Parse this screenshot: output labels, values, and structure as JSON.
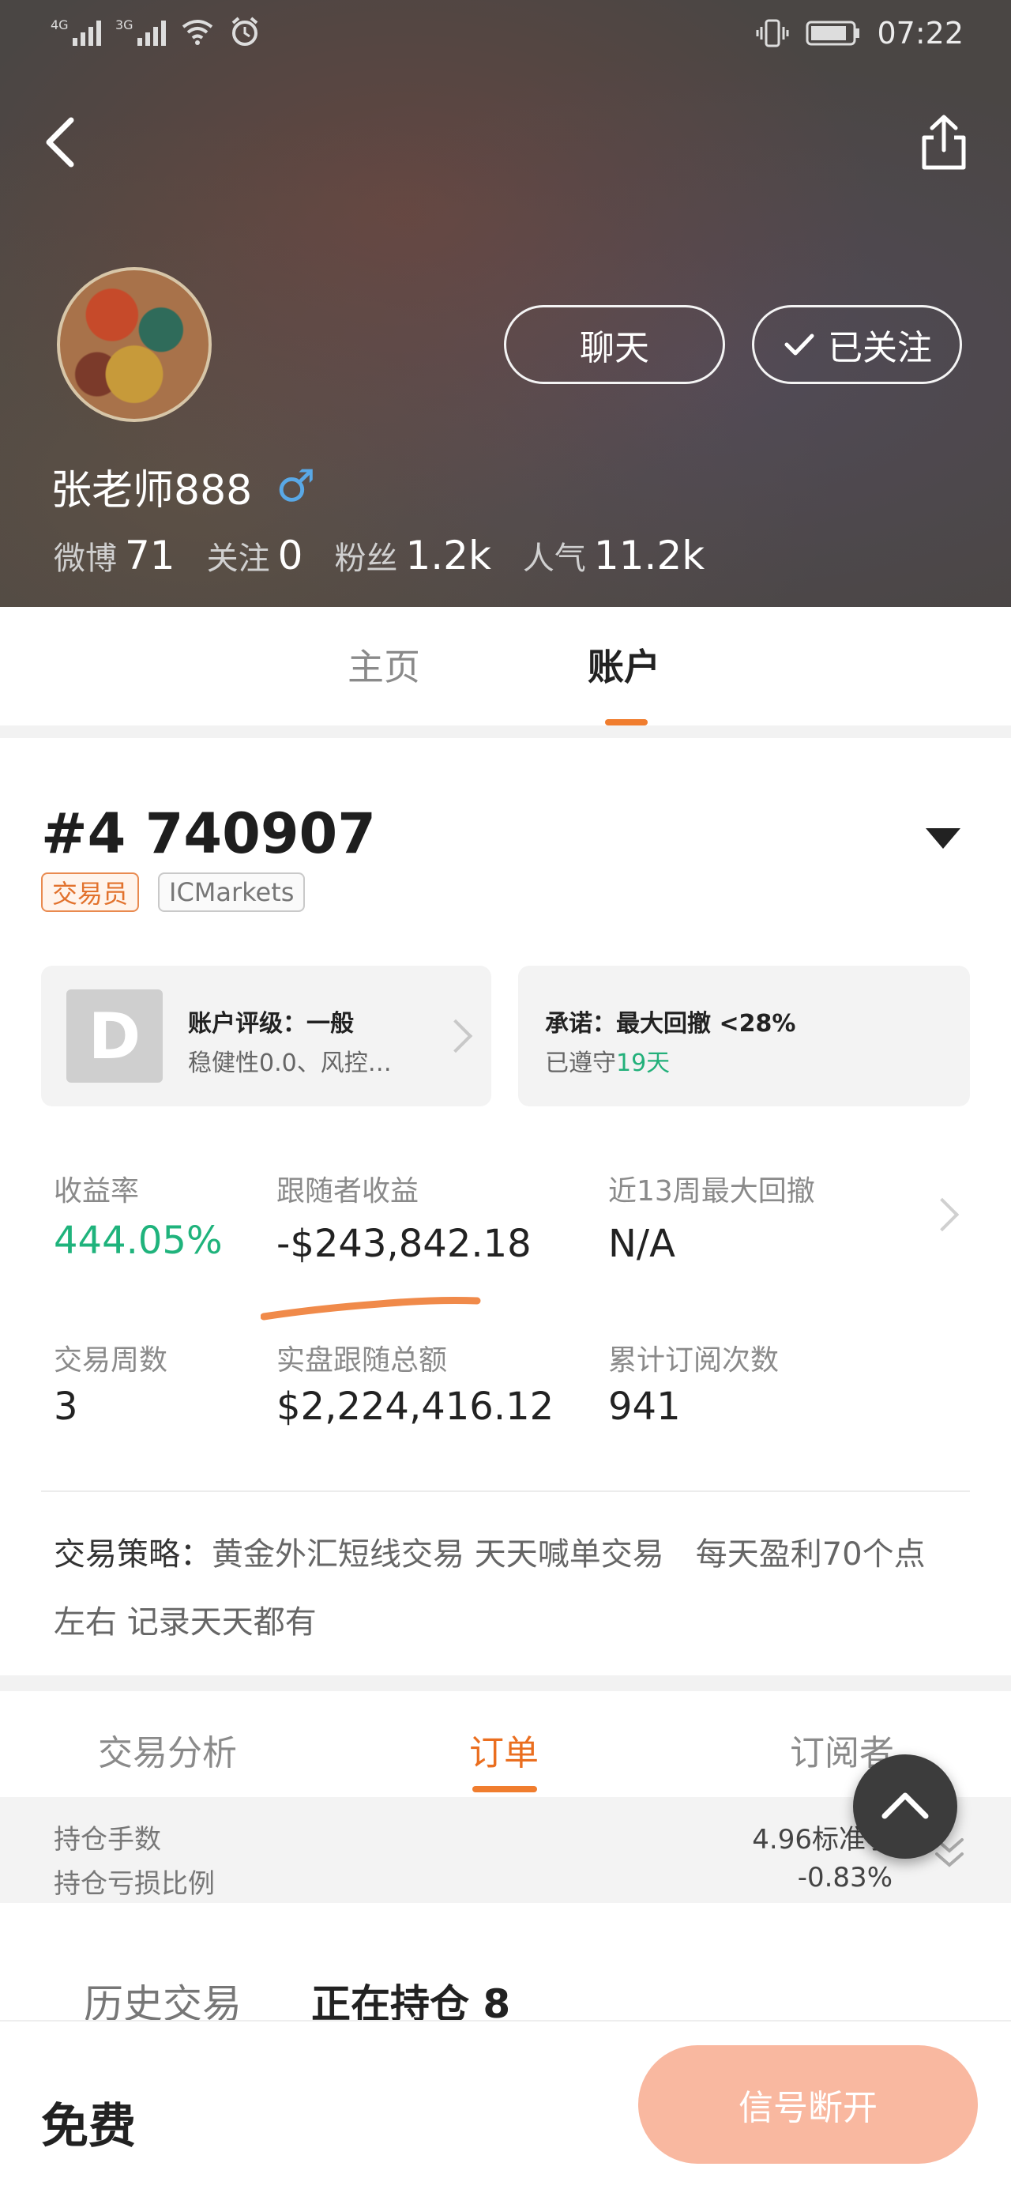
{
  "status_bar": {
    "signal1_label": "4G",
    "signal2_label": "3G",
    "time": "07:22"
  },
  "profile": {
    "chat_label": "聊天",
    "follow_label": "已关注",
    "username": "张老师888",
    "gender_symbol": "♂",
    "stats": [
      {
        "label": "微博",
        "value": "71"
      },
      {
        "label": "关注",
        "value": "0"
      },
      {
        "label": "粉丝",
        "value": "1.2k"
      },
      {
        "label": "人气",
        "value": "11.2k"
      }
    ]
  },
  "tabs": [
    {
      "label": "主页",
      "active": false
    },
    {
      "label": "账户",
      "active": true
    }
  ],
  "account": {
    "number": "#4 740907",
    "tag_trader": "交易员",
    "tag_broker": "ICMarkets",
    "rating": {
      "grade": "D",
      "title": "账户评级：一般",
      "subtitle": "稳健性0.0、风控…"
    },
    "promise": {
      "title": "承诺：最大回撤 <28%",
      "kept_prefix": "已遵守",
      "kept_days": "19天"
    },
    "metrics": {
      "return_label": "收益率",
      "return_value": "444.05%",
      "follower_profit_label": "跟随者收益",
      "follower_profit_value": "-$243,842.18",
      "max_drawdown_label": "近13周最大回撤",
      "max_drawdown_value": "N/A",
      "weeks_label": "交易周数",
      "weeks_value": "3",
      "follow_total_label": "实盘跟随总额",
      "follow_total_value": "$2,224,416.12",
      "subscriptions_label": "累计订阅次数",
      "subscriptions_value": "941"
    },
    "strategy_label": "交易策略：",
    "strategy_text": "黄金外汇短线交易 天天喊单交易　每天盈利70个点左右 记录天天都有"
  },
  "section_tabs": [
    {
      "label": "交易分析",
      "active": false
    },
    {
      "label": "订单",
      "active": true
    },
    {
      "label": "订阅者",
      "active": false
    }
  ],
  "position_summary": {
    "lots_label": "持仓手数",
    "lots_value": "4.96标准手",
    "loss_ratio_label": "持仓亏损比例",
    "loss_ratio_value": "-0.83%"
  },
  "history_tabs": {
    "history_label": "历史交易",
    "open_label": "正在持仓 8"
  },
  "bottom": {
    "price_label": "免费",
    "signal_button": "信号断开"
  },
  "colors": {
    "accent_orange": "#f07d2e",
    "profit_green": "#1fb37c",
    "signal_button_bg": "#f9b8a0"
  }
}
